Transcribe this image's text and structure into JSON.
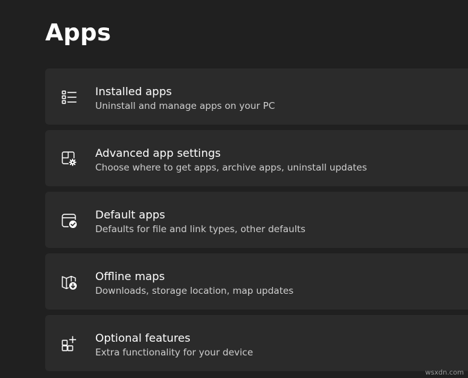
{
  "page": {
    "title": "Apps"
  },
  "items": [
    {
      "title": "Installed apps",
      "subtitle": "Uninstall and manage apps on your PC",
      "icon": "list-icon"
    },
    {
      "title": "Advanced app settings",
      "subtitle": "Choose where to get apps, archive apps, uninstall updates",
      "icon": "apps-gear-icon"
    },
    {
      "title": "Default apps",
      "subtitle": "Defaults for file and link types, other defaults",
      "icon": "window-check-icon"
    },
    {
      "title": "Offline maps",
      "subtitle": "Downloads, storage location, map updates",
      "icon": "map-download-icon"
    },
    {
      "title": "Optional features",
      "subtitle": "Extra functionality for your device",
      "icon": "apps-add-icon"
    }
  ],
  "watermark": "wsxdn.com",
  "colors": {
    "background": "#202020",
    "card": "#2b2b2b",
    "text": "#ffffff",
    "subtext": "#cfcfcf"
  }
}
